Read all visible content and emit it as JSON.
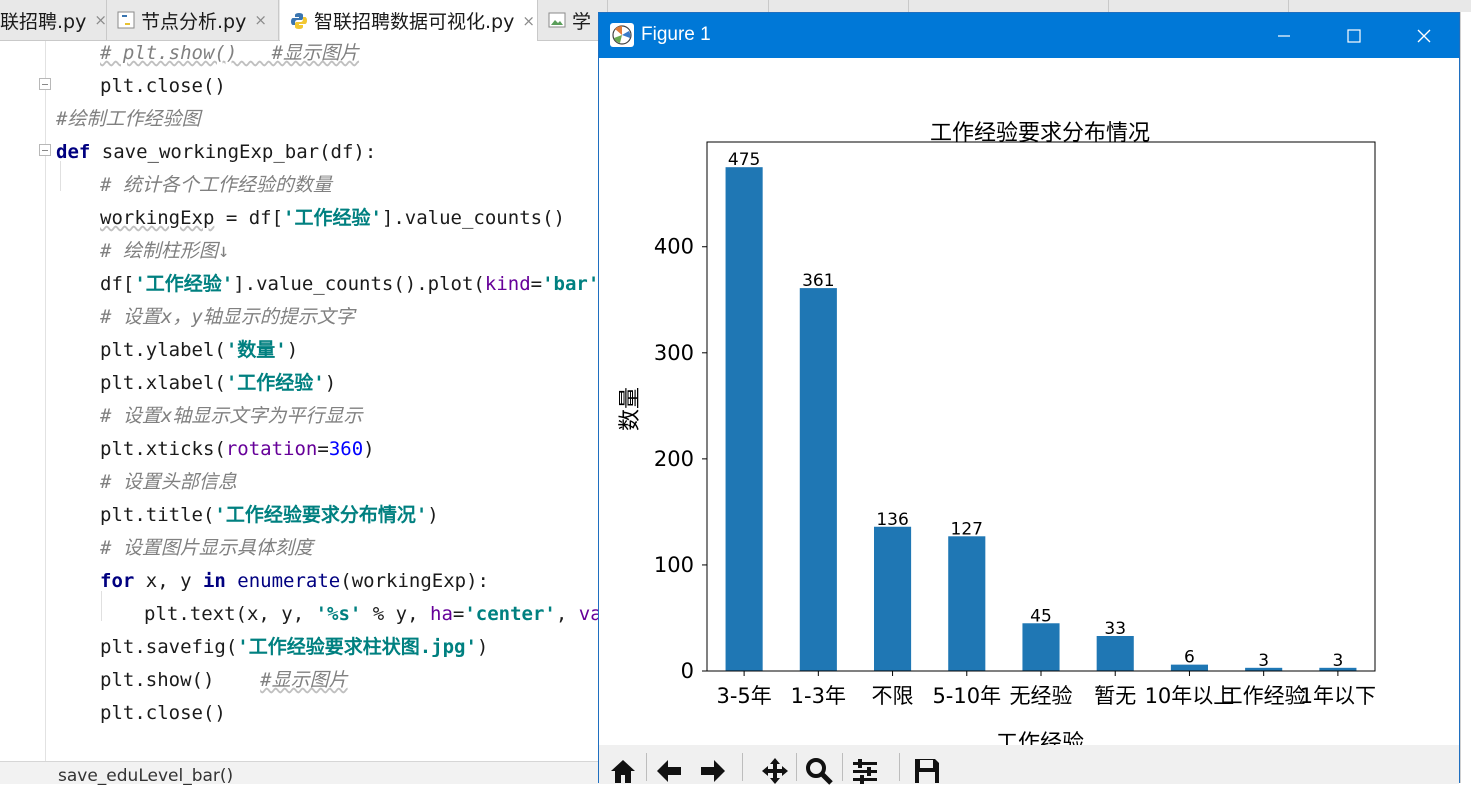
{
  "tabs": [
    {
      "label": "联招聘.py",
      "active": false
    },
    {
      "label": "节点分析.py",
      "active": false
    },
    {
      "label": "智联招聘数据可视化.py",
      "active": true
    },
    {
      "label": "学",
      "active": false
    }
  ],
  "tab_close_glyph": "×",
  "code": {
    "line1": {
      "comment": "# plt.show()   #显示图片"
    },
    "line2": {
      "text": "plt.close()"
    },
    "line3": {
      "comment": "#绘制工作经验图"
    },
    "line4": {
      "kw": "def",
      "name": " save_workingExp_bar(df):"
    },
    "line5": {
      "comment": "# 统计各个工作经验的数量"
    },
    "line6": {
      "a": "workingExp",
      "b": " = df[",
      "s": "'工作经验'",
      "c": "].value_counts()"
    },
    "line7": {
      "comment": "# 绘制柱形图↓"
    },
    "line8": {
      "a": "df[",
      "s": "'工作经验'",
      "b": "].value_counts().plot(",
      "arg": "kind",
      "eq": "=",
      "s2": "'bar'"
    },
    "line9": {
      "comment": "# 设置x，y轴显示的提示文字"
    },
    "line10": {
      "a": "plt.ylabel(",
      "s": "'数量'",
      "b": ")"
    },
    "line11": {
      "a": "plt.xlabel(",
      "s": "'工作经验'",
      "b": ")"
    },
    "line12": {
      "comment": "# 设置x轴显示文字为平行显示"
    },
    "line13": {
      "a": "plt.xticks(",
      "arg": "rotation",
      "eq": "=",
      "num": "360",
      "b": ")"
    },
    "line14": {
      "comment": "# 设置头部信息"
    },
    "line15": {
      "a": "plt.title(",
      "s": "'工作经验要求分布情况'",
      "b": ")"
    },
    "line16": {
      "comment": "# 设置图片显示具体刻度"
    },
    "line17": {
      "kw1": "for",
      "a": " x, y ",
      "kw2": "in",
      "fn": " enumerate",
      "b": "(workingExp):"
    },
    "line18": {
      "a": "plt.text(x, y, ",
      "s": "'%s'",
      "b": " % y, ",
      "arg": "ha",
      "eq": "=",
      "s2": "'center'",
      "c": ", ",
      "arg2": "va"
    },
    "line19": {
      "a": "plt.savefig(",
      "s": "'工作经验要求柱状图.jpg'",
      "b": ")"
    },
    "line20": {
      "a": "plt.show()    ",
      "comment": "#显示图片"
    },
    "line21": {
      "text": "plt.close()"
    }
  },
  "status": {
    "text": "save_eduLevel_bar()"
  },
  "figure": {
    "title": "Figure 1",
    "controls": {
      "minimize": "minimize",
      "maximize": "maximize",
      "close": "close"
    },
    "toolbar": [
      "home-icon",
      "back-icon",
      "forward-icon",
      "pan-icon",
      "zoom-icon",
      "configure-icon",
      "save-icon"
    ]
  },
  "chart_data": {
    "type": "bar",
    "title": "工作经验要求分布情况",
    "xlabel": "工作经验",
    "ylabel": "数量",
    "categories": [
      "3-5年",
      "1-3年",
      "不限",
      "5-10年",
      "无经验",
      "暂无",
      "10年以上",
      "工作经验",
      "1年以下"
    ],
    "values": [
      475,
      361,
      136,
      127,
      45,
      33,
      6,
      3,
      3
    ],
    "data_labels": [
      "475",
      "361",
      "136",
      "127",
      "45",
      "33",
      "6",
      "3",
      "3"
    ],
    "yticks": [
      0,
      100,
      200,
      300,
      400
    ],
    "ylim": [
      0,
      498.75
    ],
    "bar_color": "#1f77b4",
    "grid": false
  }
}
